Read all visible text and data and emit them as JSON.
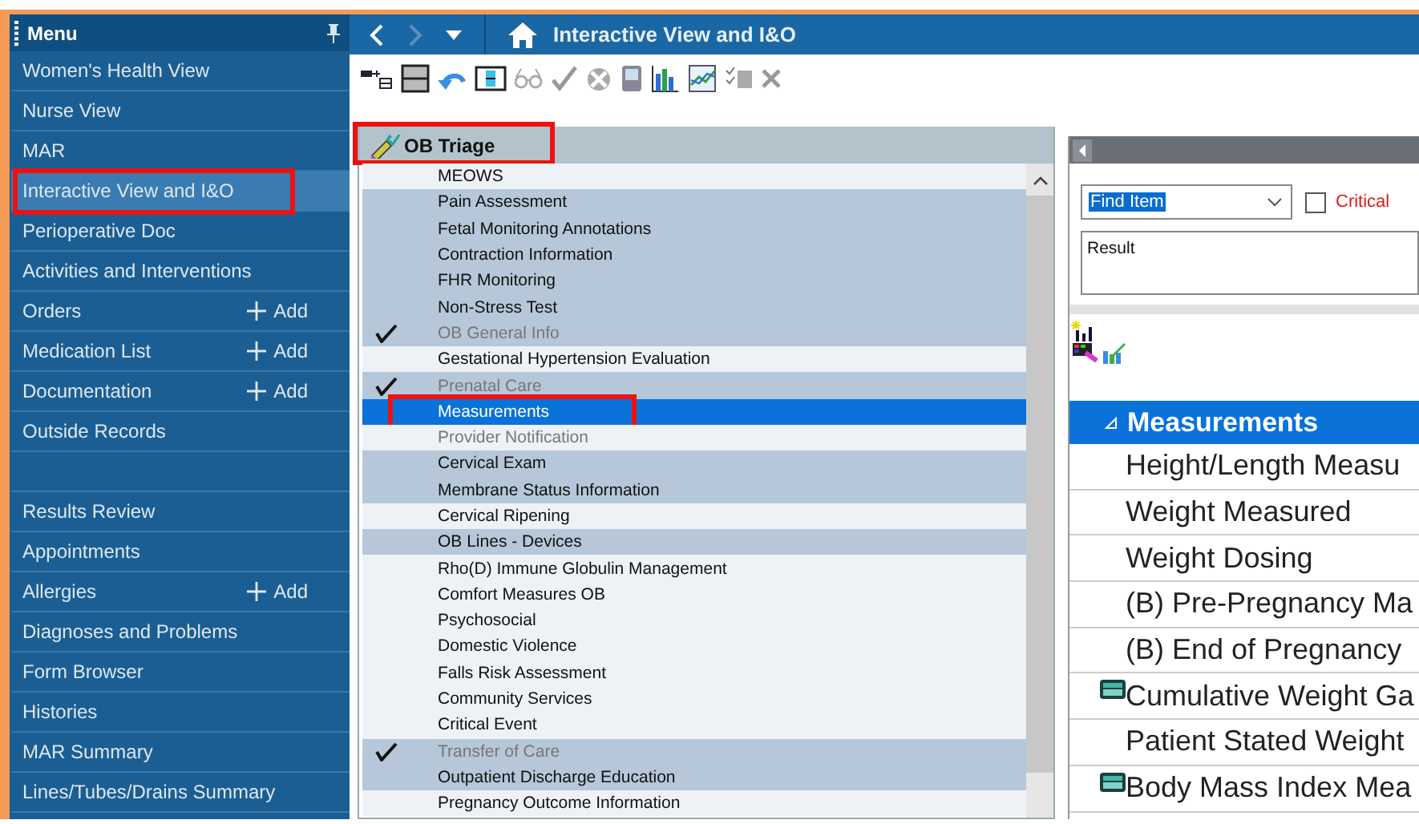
{
  "sidebar": {
    "title": "Menu",
    "items": [
      {
        "kind": "link",
        "label": "Women's Health View",
        "selected": false,
        "highlighted": false
      },
      {
        "kind": "link",
        "label": "Nurse View",
        "selected": false,
        "highlighted": false
      },
      {
        "kind": "link",
        "label": "MAR",
        "selected": false,
        "highlighted": false
      },
      {
        "kind": "link",
        "label": "Interactive View and I&O",
        "selected": true,
        "highlighted": true
      },
      {
        "kind": "link",
        "label": "Perioperative Doc",
        "selected": false,
        "highlighted": false
      },
      {
        "kind": "link",
        "label": "Activities and Interventions",
        "selected": false,
        "highlighted": false
      },
      {
        "kind": "link",
        "label": "Orders",
        "selected": false,
        "highlighted": false,
        "action": "Add"
      },
      {
        "kind": "link",
        "label": "Medication List",
        "selected": false,
        "highlighted": false,
        "action": "Add"
      },
      {
        "kind": "link",
        "label": "Documentation",
        "selected": false,
        "highlighted": false,
        "action": "Add"
      },
      {
        "kind": "link",
        "label": "Outside Records",
        "selected": false,
        "highlighted": false
      },
      {
        "kind": "blank"
      },
      {
        "kind": "link",
        "label": "Results Review",
        "selected": false,
        "highlighted": false
      },
      {
        "kind": "link",
        "label": "Appointments",
        "selected": false,
        "highlighted": false
      },
      {
        "kind": "link",
        "label": "Allergies",
        "selected": false,
        "highlighted": false,
        "action": "Add"
      },
      {
        "kind": "link",
        "label": "Diagnoses and Problems",
        "selected": false,
        "highlighted": false
      },
      {
        "kind": "link",
        "label": "Form Browser",
        "selected": false,
        "highlighted": false
      },
      {
        "kind": "link",
        "label": "Histories",
        "selected": false,
        "highlighted": false
      },
      {
        "kind": "link",
        "label": "MAR Summary",
        "selected": false,
        "highlighted": false
      },
      {
        "kind": "link",
        "label": "Lines/Tubes/Drains Summary",
        "selected": false,
        "highlighted": false
      }
    ]
  },
  "header": {
    "title": "Interactive View and I&O"
  },
  "band": {
    "title": "OB Triage",
    "highlighted": true
  },
  "sections": [
    {
      "label": "MEOWS",
      "shaded": false,
      "checked": false,
      "dimmed": false,
      "selected": false,
      "highlighted": false
    },
    {
      "label": "Pain Assessment",
      "shaded": true,
      "checked": false,
      "dimmed": false,
      "selected": false,
      "highlighted": false
    },
    {
      "label": "Fetal Monitoring Annotations",
      "shaded": true,
      "checked": false,
      "dimmed": false,
      "selected": false,
      "highlighted": false
    },
    {
      "label": "Contraction Information",
      "shaded": true,
      "checked": false,
      "dimmed": false,
      "selected": false,
      "highlighted": false
    },
    {
      "label": "FHR Monitoring",
      "shaded": true,
      "checked": false,
      "dimmed": false,
      "selected": false,
      "highlighted": false
    },
    {
      "label": "Non-Stress Test",
      "shaded": true,
      "checked": false,
      "dimmed": false,
      "selected": false,
      "highlighted": false
    },
    {
      "label": "OB General Info",
      "shaded": true,
      "checked": true,
      "dimmed": true,
      "selected": false,
      "highlighted": false
    },
    {
      "label": "Gestational Hypertension Evaluation",
      "shaded": false,
      "checked": false,
      "dimmed": false,
      "selected": false,
      "highlighted": false
    },
    {
      "label": "Prenatal Care",
      "shaded": true,
      "checked": true,
      "dimmed": true,
      "selected": false,
      "highlighted": false
    },
    {
      "label": "Measurements",
      "shaded": false,
      "checked": false,
      "dimmed": false,
      "selected": true,
      "highlighted": true
    },
    {
      "label": "Provider Notification",
      "shaded": false,
      "checked": false,
      "dimmed": true,
      "selected": false,
      "highlighted": false
    },
    {
      "label": "Cervical Exam",
      "shaded": true,
      "checked": false,
      "dimmed": false,
      "selected": false,
      "highlighted": false
    },
    {
      "label": "Membrane Status Information",
      "shaded": true,
      "checked": false,
      "dimmed": false,
      "selected": false,
      "highlighted": false
    },
    {
      "label": "Cervical Ripening",
      "shaded": false,
      "checked": false,
      "dimmed": false,
      "selected": false,
      "highlighted": false
    },
    {
      "label": "OB Lines - Devices",
      "shaded": true,
      "checked": false,
      "dimmed": false,
      "selected": false,
      "highlighted": false
    },
    {
      "label": "Rho(D) Immune Globulin Management",
      "shaded": false,
      "checked": false,
      "dimmed": false,
      "selected": false,
      "highlighted": false
    },
    {
      "label": "Comfort Measures OB",
      "shaded": false,
      "checked": false,
      "dimmed": false,
      "selected": false,
      "highlighted": false
    },
    {
      "label": "Psychosocial",
      "shaded": false,
      "checked": false,
      "dimmed": false,
      "selected": false,
      "highlighted": false
    },
    {
      "label": "Domestic Violence",
      "shaded": false,
      "checked": false,
      "dimmed": false,
      "selected": false,
      "highlighted": false
    },
    {
      "label": "Falls Risk Assessment",
      "shaded": false,
      "checked": false,
      "dimmed": false,
      "selected": false,
      "highlighted": false
    },
    {
      "label": "Community Services",
      "shaded": false,
      "checked": false,
      "dimmed": false,
      "selected": false,
      "highlighted": false
    },
    {
      "label": "Critical Event",
      "shaded": false,
      "checked": false,
      "dimmed": false,
      "selected": false,
      "highlighted": false
    },
    {
      "label": "Transfer of Care",
      "shaded": true,
      "checked": true,
      "dimmed": true,
      "selected": false,
      "highlighted": false
    },
    {
      "label": "Outpatient Discharge Education",
      "shaded": true,
      "checked": false,
      "dimmed": false,
      "selected": false,
      "highlighted": false
    },
    {
      "label": "Pregnancy Outcome Information",
      "shaded": false,
      "checked": false,
      "dimmed": false,
      "selected": false,
      "highlighted": false
    }
  ],
  "finder": {
    "value": "Find Item",
    "critical_label": "Critical",
    "critical_checked": false,
    "result_placeholder": "Result"
  },
  "flowsheet": {
    "title": "Measurements",
    "expanded": true,
    "rows": [
      {
        "label": "Height/Length Measu",
        "kind": "plain"
      },
      {
        "label": "Weight Measured",
        "kind": "plain"
      },
      {
        "label": "Weight Dosing",
        "kind": "plain"
      },
      {
        "label": "(B) Pre-Pregnancy Ma",
        "kind": "plain"
      },
      {
        "label": "(B) End of Pregnancy",
        "kind": "plain"
      },
      {
        "label": "Cumulative Weight Ga",
        "kind": "calc"
      },
      {
        "label": "Patient Stated Weight",
        "kind": "plain"
      },
      {
        "label": "Body Mass Index Mea",
        "kind": "calc"
      }
    ]
  }
}
